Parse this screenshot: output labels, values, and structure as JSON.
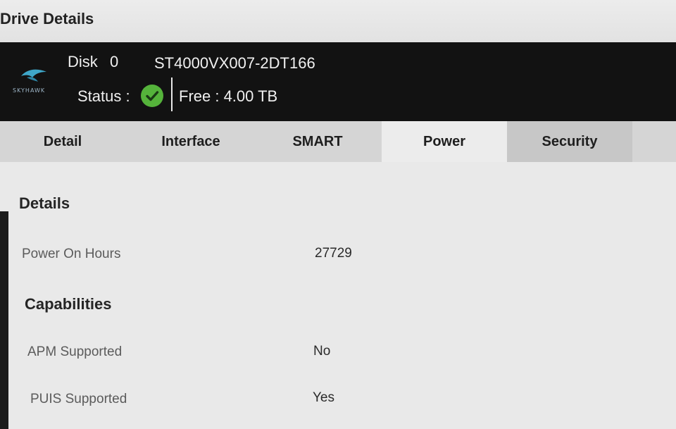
{
  "window": {
    "title": "Drive Details"
  },
  "header": {
    "brand": "SKYHAWK",
    "disk_label": "Disk",
    "disk_number": "0",
    "model": "ST4000VX007-2DT166",
    "status_label": "Status :",
    "status_icon": "check-circle-icon",
    "status_color": "#55b33b",
    "free_text": "Free : 4.00 TB"
  },
  "tabs": [
    {
      "label": "Detail",
      "active": false
    },
    {
      "label": "Interface",
      "active": false
    },
    {
      "label": "SMART",
      "active": false
    },
    {
      "label": "Power",
      "active": true
    },
    {
      "label": "Security",
      "active": false
    }
  ],
  "details": {
    "heading": "Details",
    "rows": [
      {
        "label": "Power On Hours",
        "value": "27729"
      }
    ]
  },
  "capabilities": {
    "heading": "Capabilities",
    "rows": [
      {
        "label": "APM Supported",
        "value": "No"
      },
      {
        "label": "PUIS Supported",
        "value": "Yes"
      }
    ]
  }
}
